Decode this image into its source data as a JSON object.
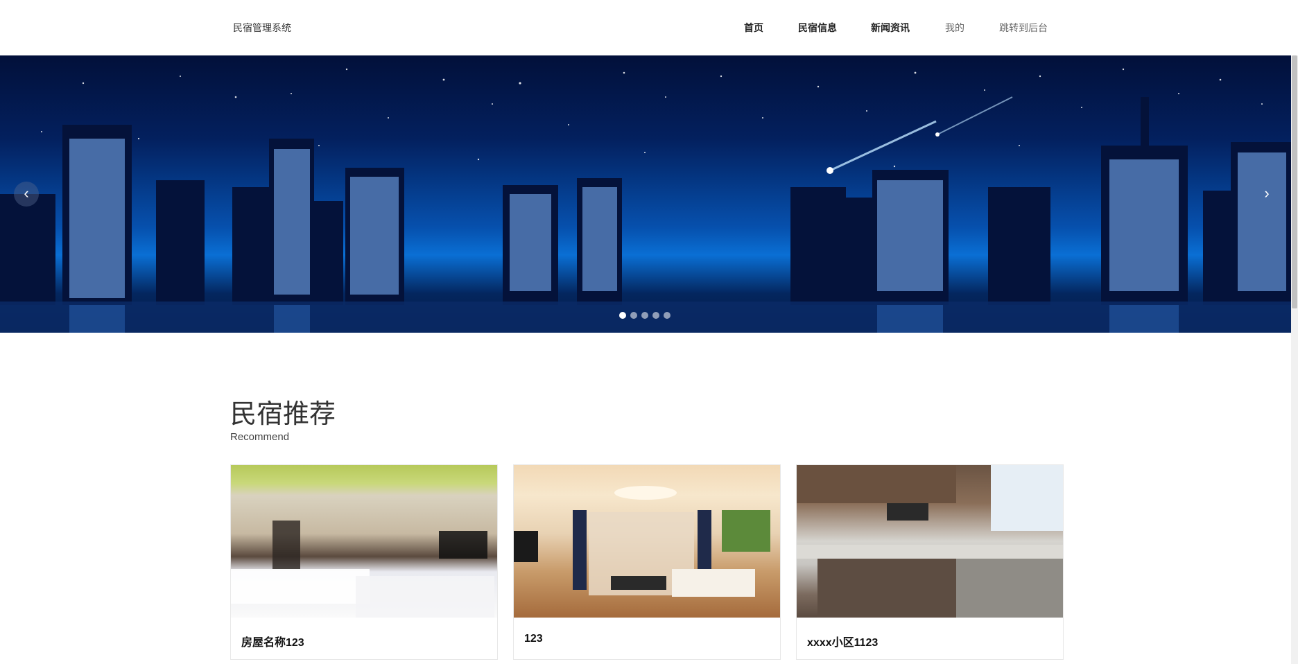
{
  "header": {
    "brand": "民宿管理系统",
    "nav": {
      "home": "首页",
      "homestay_info": "民宿信息",
      "news": "新闻资讯",
      "mine": "我的",
      "admin": "跳转到后台"
    }
  },
  "banner": {
    "prev_icon": "chevron-left-icon",
    "next_icon": "chevron-right-icon",
    "prev_glyph": "‹",
    "next_glyph": "›",
    "slide_count": 5,
    "active_slide": 1
  },
  "section": {
    "title": "民宿推荐",
    "subtitle": "Recommend",
    "cards": [
      {
        "title": "房屋名称123"
      },
      {
        "title": "123"
      },
      {
        "title": "xxxx小区1123"
      }
    ]
  },
  "colors": {
    "accent_text": "#333333",
    "banner_sky_top": "#02103a",
    "banner_sky_mid": "#0650ad"
  }
}
